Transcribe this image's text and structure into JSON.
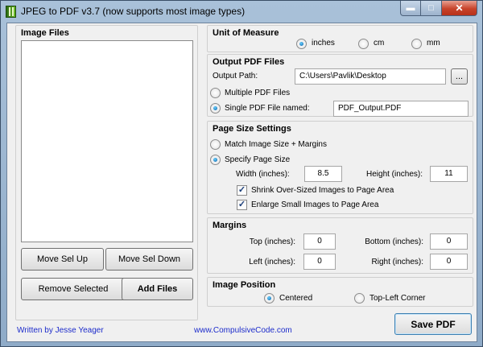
{
  "window": {
    "title": "JPEG to PDF  v3.7    (now supports most image types)",
    "controls": {
      "minimize": "▬",
      "maximize": "□",
      "close": "✕"
    }
  },
  "image_files": {
    "title": "Image Files",
    "buttons": {
      "move_up": "Move Sel Up",
      "move_down": "Move Sel Down",
      "remove": "Remove Selected",
      "add": "Add Files"
    }
  },
  "unit_of_measure": {
    "title": "Unit of Measure",
    "options": [
      "inches",
      "cm",
      "mm"
    ],
    "selected": "inches"
  },
  "output": {
    "title": "Output PDF Files",
    "path_label": "Output Path:",
    "path_value": "C:\\Users\\Pavlik\\Desktop",
    "browse_label": "...",
    "multiple_label": "Multiple PDF Files",
    "single_label": "Single PDF File named:",
    "selected": "single",
    "filename_value": "PDF_Output.PDF"
  },
  "page_size": {
    "title": "Page Size Settings",
    "match_label": "Match Image Size + Margins",
    "specify_label": "Specify Page Size",
    "selected": "specify",
    "width_label": "Width (inches):",
    "width_value": "8.5",
    "height_label": "Height (inches):",
    "height_value": "11",
    "shrink_label": "Shrink Over-Sized Images to Page Area",
    "shrink_checked": true,
    "enlarge_label": "Enlarge Small Images to Page Area",
    "enlarge_checked": true
  },
  "margins": {
    "title": "Margins",
    "top_label": "Top (inches):",
    "top_value": "0",
    "bottom_label": "Bottom (inches):",
    "bottom_value": "0",
    "left_label": "Left (inches):",
    "left_value": "0",
    "right_label": "Right (inches):",
    "right_value": "0"
  },
  "image_position": {
    "title": "Image Position",
    "centered_label": "Centered",
    "topleft_label": "Top-Left Corner",
    "selected": "centered"
  },
  "footer": {
    "author": "Written by Jesse Yeager",
    "website": "www.CompulsiveCode.com",
    "save_label": "Save PDF"
  },
  "colors": {
    "link": "#1d2ccb",
    "radio_fill": "#0a5ea6",
    "titlebar": "#a9c1d9",
    "close_button": "#c7432a"
  }
}
